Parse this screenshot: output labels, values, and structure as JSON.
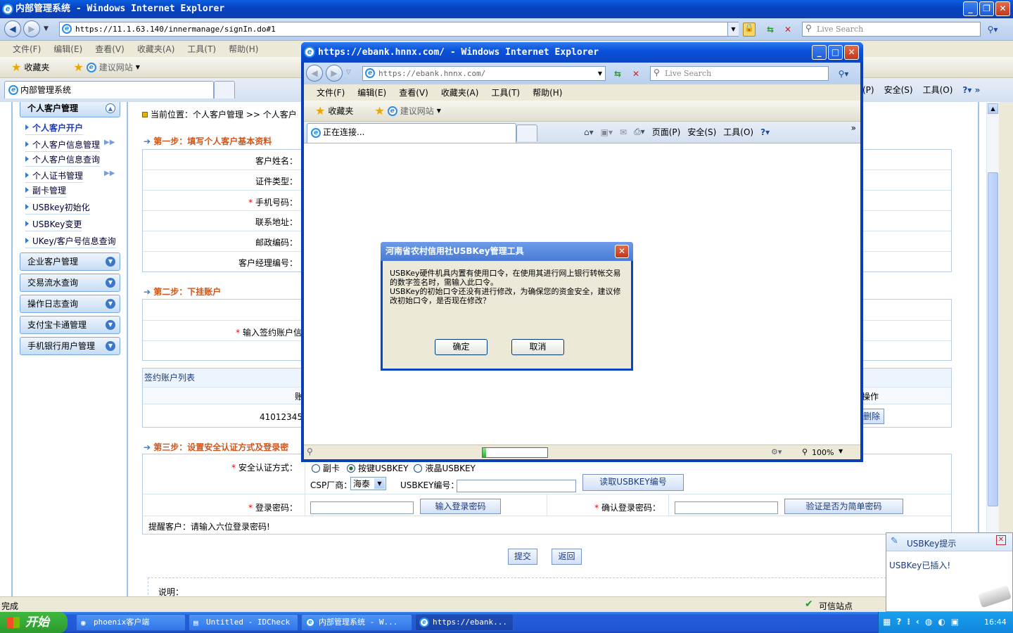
{
  "main_window": {
    "title": "内部管理系统 - Windows Internet Explorer",
    "address": "https://11.1.63.140/innermanage/signIn.do#1",
    "search_placeholder": "Live Search",
    "menu": [
      "文件(F)",
      "编辑(E)",
      "查看(V)",
      "收藏夹(A)",
      "工具(T)",
      "帮助(H)"
    ],
    "favorites_label": "收藏夹",
    "suggested_sites": "建议网站",
    "tab_label": "内部管理系统",
    "toolbar_right": [
      "(P)",
      "安全(S)",
      "工具(O)"
    ],
    "status_text": "完成",
    "zone_text": "可信站点"
  },
  "sidebar": {
    "group_personal": "个人客户管理",
    "items": [
      "个人客户开户",
      "个人客户信息管理",
      "个人客户信息查询",
      "个人证书管理",
      "副卡管理",
      "USBkey初始化",
      "USBKey变更",
      "UKey/客户号信息查询"
    ],
    "groups": [
      "企业客户管理",
      "交易流水查询",
      "操作日志查询",
      "支付宝卡通管理",
      "手机银行用户管理"
    ]
  },
  "content": {
    "breadcrumb": "当前位置：个人客户管理 >> 个人客户",
    "step1": "第一步：填写个人客户基本资料",
    "step1_labels": [
      "客户姓名：",
      "证件类型：",
      "手机号码：",
      "联系地址：",
      "邮政编码：",
      "客户经理编号："
    ],
    "step2": "第二步：下挂账户",
    "account_input_label": "输入签约账户信",
    "account_list_title": "签约账户列表",
    "account_col_partial": "账",
    "operation_col": "操作",
    "account_number": "41012345",
    "delete_label": "删除",
    "step3": "第三步：设置安全认证方式及登录密",
    "auth_label": "安全认证方式：",
    "auth_options": [
      "副卡",
      "按键USBKEY",
      "液晶USBKEY"
    ],
    "csp_label": "CSP厂商：",
    "csp_value": "海泰",
    "usbkey_no_label": "USBKEY编号：",
    "read_usbkey_btn": "读取USBKEY编号",
    "login_pwd_label": "登录密码：",
    "input_login_pwd_btn": "输入登录密码",
    "confirm_pwd_label": "确认登录密码：",
    "verify_simple_btn": "验证是否为简单密码",
    "reminder": "提醒客户：请输入六位登录密码!",
    "submit_btn": "提交",
    "back_btn": "返回",
    "note_label": "说明："
  },
  "popup": {
    "title": "https://ebank.hnnx.com/ - Windows Internet Explorer",
    "address": "https://ebank.hnnx.com/",
    "search_placeholder": "Live Search",
    "menu": [
      "文件(F)",
      "编辑(E)",
      "查看(V)",
      "收藏夹(A)",
      "工具(T)",
      "帮助(H)"
    ],
    "favorites_label": "收藏夹",
    "suggested_sites": "建议网站",
    "tab_label": "正在连接...",
    "toolbar": [
      "页面(P)",
      "安全(S)",
      "工具(O)"
    ],
    "zoom": "100%",
    "progress": 0.05
  },
  "dialog": {
    "title": "河南省农村信用社USBKey管理工具",
    "message_line1": "USBKey硬件机具内置有使用口令，在使用其进行网上银行转帐交易的数字签名时，需输入此口令。",
    "message_line2": "USBKey的初始口令还没有进行修改，为确保您的资金安全，建议修改初始口令，是否现在修改？",
    "ok": "确定",
    "cancel": "取消"
  },
  "notification": {
    "title": "USBKey提示",
    "message": "USBKey已插入!"
  },
  "taskbar": {
    "start": "开始",
    "tasks": [
      "phoenix客户端",
      "Untitled - IDCheck",
      "内部管理系统 - W...",
      "https://ebank..."
    ],
    "clock": "16:44"
  }
}
